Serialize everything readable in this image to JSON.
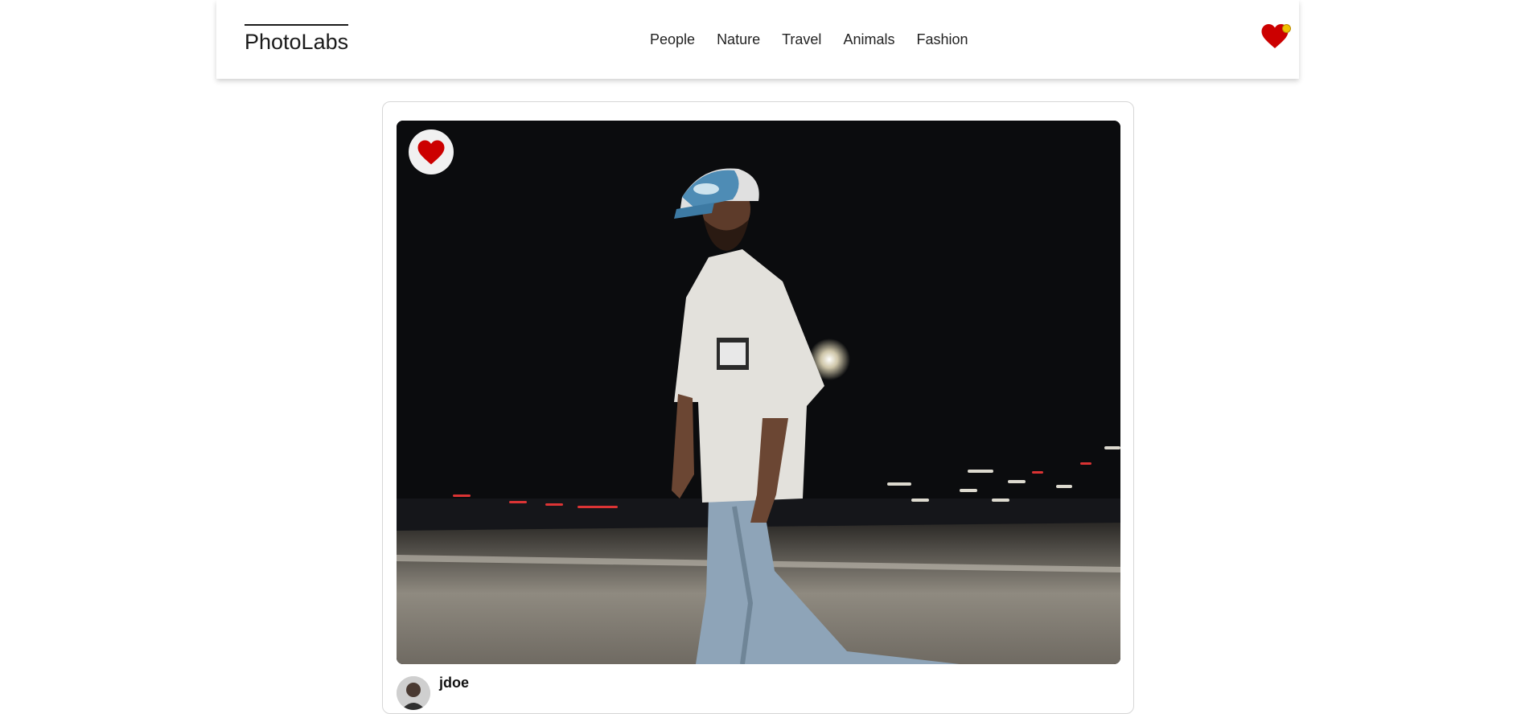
{
  "header": {
    "logo": "PhotoLabs",
    "nav": [
      "People",
      "Nature",
      "Travel",
      "Animals",
      "Fashion"
    ],
    "favorites_badge_icon": "heart-icon",
    "notification_dot_color": "#f0c000"
  },
  "card": {
    "favorite_icon": "heart-icon",
    "favorite_color": "#cc0000",
    "photo_icon": "photo-night-walker",
    "user": {
      "username": "jdoe",
      "avatar_icon": "avatar-icon"
    }
  }
}
